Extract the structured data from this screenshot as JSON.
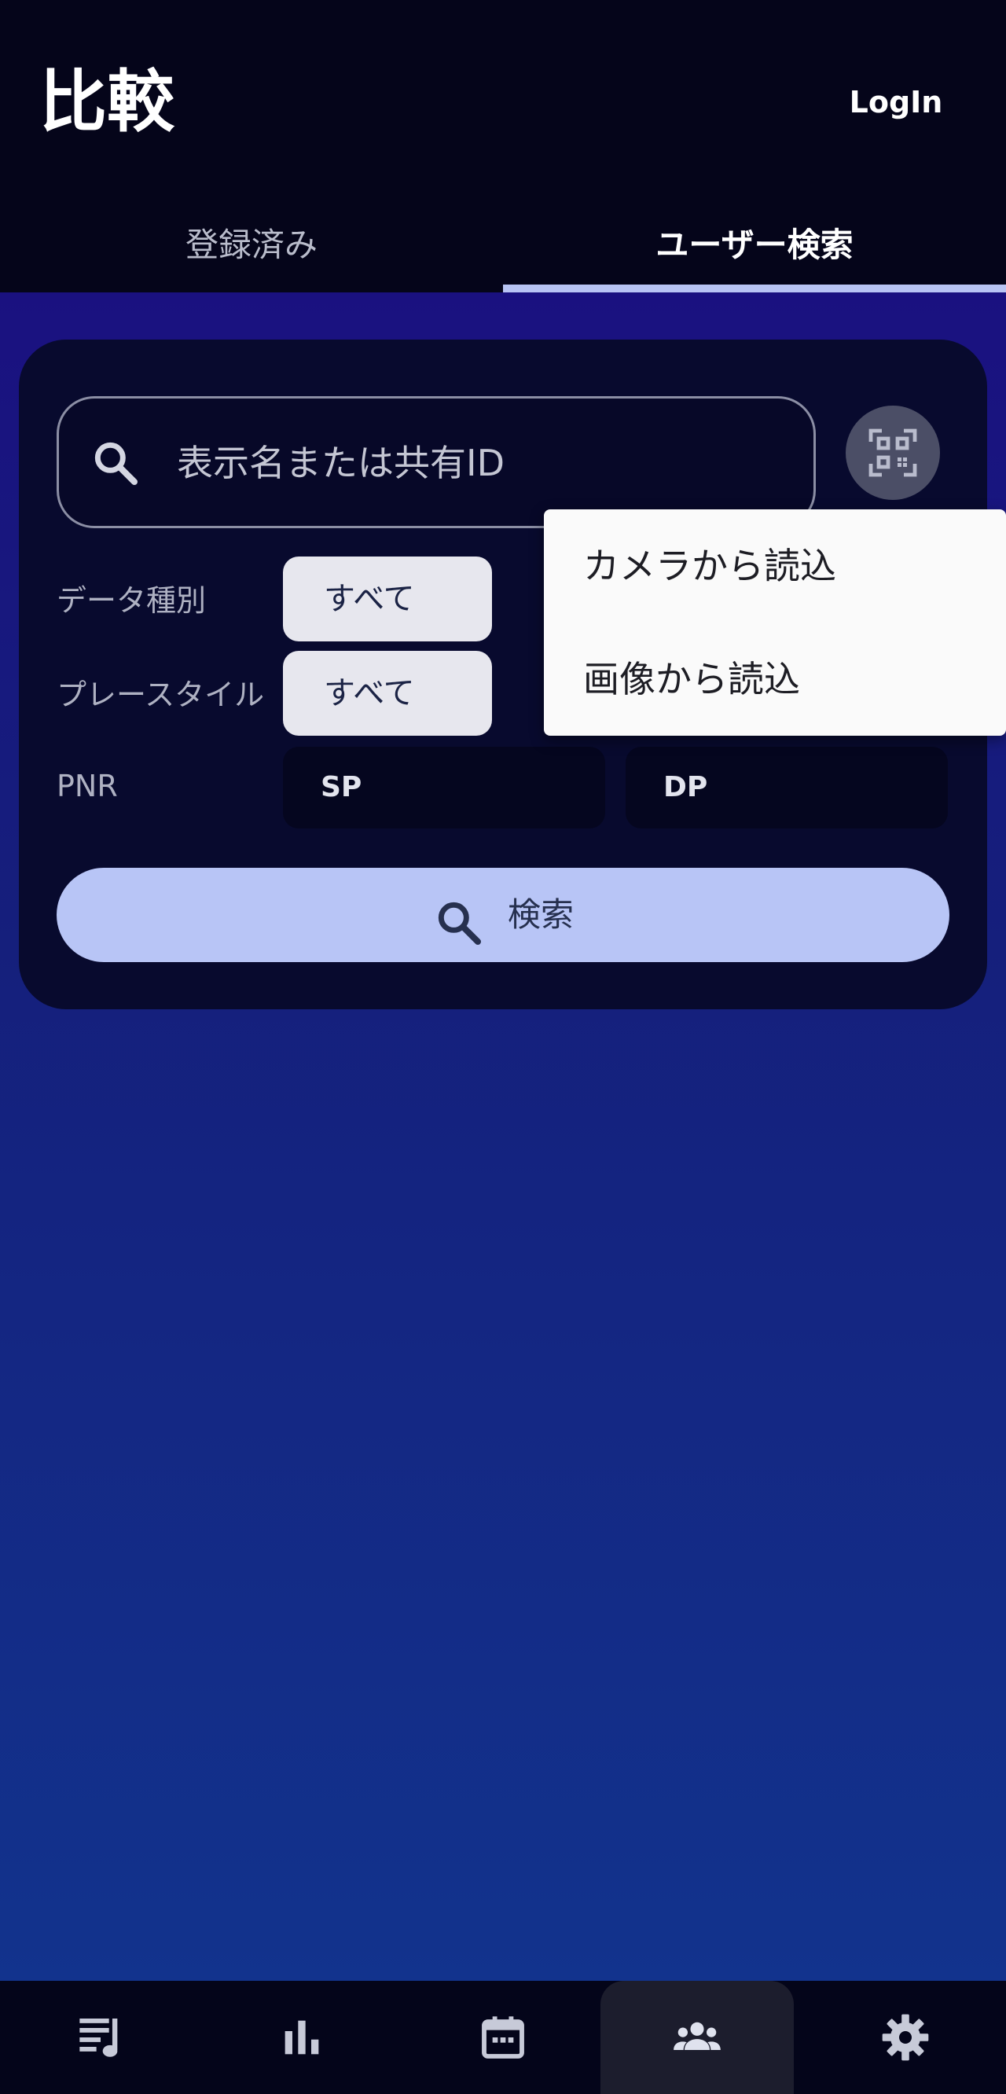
{
  "header": {
    "title": "比較",
    "login_label": "LogIn"
  },
  "tabs": [
    {
      "label": "登録済み",
      "active": false
    },
    {
      "label": "ユーザー検索",
      "active": true
    }
  ],
  "search": {
    "placeholder": "表示名または共有ID",
    "value": ""
  },
  "filters": {
    "data_type": {
      "label": "データ種別",
      "selected": "すべて"
    },
    "play_style": {
      "label": "プレースタイル",
      "selected": "すべて"
    },
    "pnr": {
      "label": "PNR",
      "options": [
        "SP",
        "DP"
      ]
    }
  },
  "search_button": {
    "label": "検索"
  },
  "qr_menu": {
    "items": [
      "カメラから読込",
      "画像から読込"
    ]
  },
  "bottom_nav": {
    "items": [
      {
        "icon": "music-list-icon",
        "active": false
      },
      {
        "icon": "bar-chart-icon",
        "active": false
      },
      {
        "icon": "calendar-icon",
        "active": false
      },
      {
        "icon": "group-icon",
        "active": true
      },
      {
        "icon": "gear-icon",
        "active": false
      }
    ]
  },
  "colors": {
    "accent": "#b8c5f6",
    "appbar": "#05051a",
    "card": "#080a2e"
  }
}
